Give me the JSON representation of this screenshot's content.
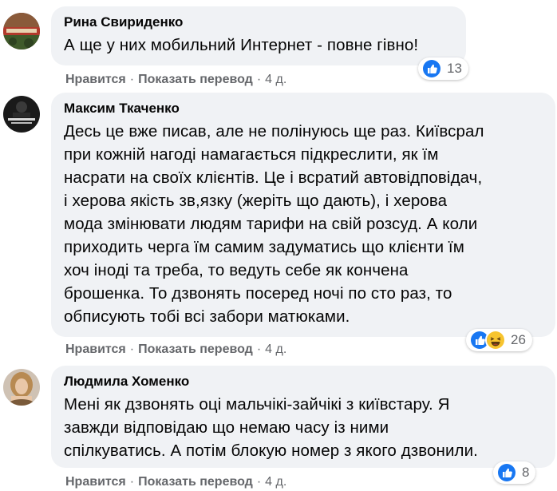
{
  "comments": [
    {
      "author": "Рина Свириденко",
      "text": "А ще у них мобильний Интернет - повне гівно!",
      "reaction_count": "13",
      "reactions": [
        "like-icon"
      ],
      "like_label": "Нравится",
      "translate_label": "Показать перевод",
      "time": "4 д."
    },
    {
      "author": "Максим Ткаченко",
      "text": "Десь це вже писав, але не полінуюсь ще раз. Київсрал\nпри кожній нагоді намагається підкреслити, як їм\nнасрати на своїх клієнтів. Це і всратий автовідповідач,\nі херова якість зв,язку (жеріть що дають), і херова\nмода змінювати людям тарифи на свій розсуд. А коли\nприходить черга їм самим задуматись що клієнти їм\nхоч іноді та треба, то ведуть себе як кончена\nброшенка. То дзвонять посеред ночі по сто раз, то\nобписують тобі всі забори матюками.",
      "reaction_count": "26",
      "reactions": [
        "like-icon",
        "haha-icon"
      ],
      "like_label": "Нравится",
      "translate_label": "Показать перевод",
      "time": "4 д."
    },
    {
      "author": "Людмила Хоменко",
      "text": "Мені як дзвонять оці мальчікі-зайчікі з київстару. Я\nзавжди відповідаю що немаю часу із ними\nспілкуватись. А потім блокую номер з якого дзвонили.",
      "reaction_count": "8",
      "reactions": [
        "like-icon"
      ],
      "like_label": "Нравится",
      "translate_label": "Показать перевод",
      "time": "4 д."
    }
  ],
  "separator": "·",
  "colors": {
    "bubble": "#f0f2f5",
    "meta_text": "#65676b",
    "like_blue": "#1877f2",
    "haha_yellow": "#f7c42f"
  }
}
